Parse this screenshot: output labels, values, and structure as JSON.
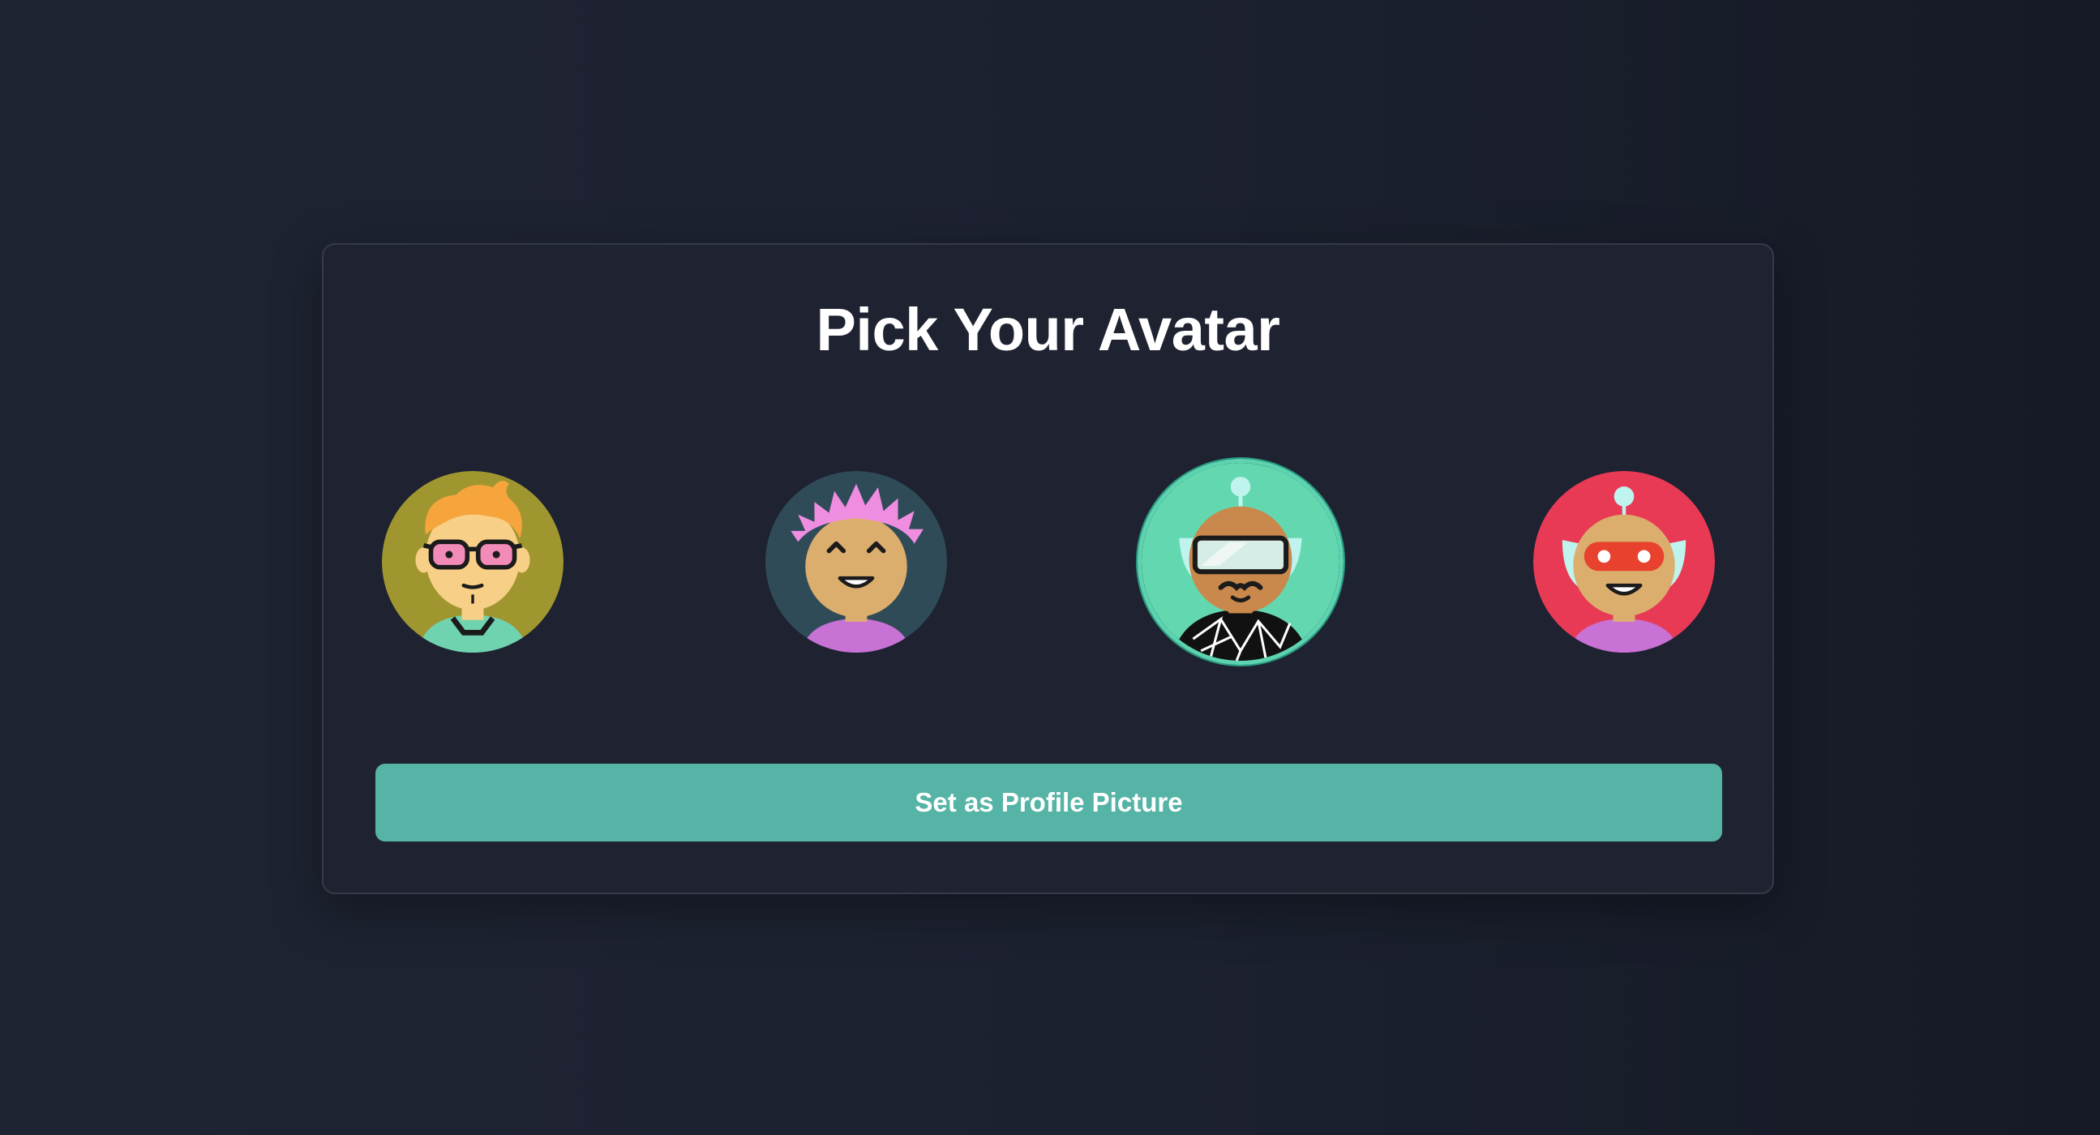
{
  "page": {
    "title": "Pick Your Avatar"
  },
  "avatars": [
    {
      "name": "avatar-1",
      "background": "#a09630",
      "selected": false
    },
    {
      "name": "avatar-2",
      "background": "#2f4b57",
      "selected": false
    },
    {
      "name": "avatar-3",
      "background": "#63d8b0",
      "selected": true
    },
    {
      "name": "avatar-4",
      "background": "#e83a55",
      "selected": false
    }
  ],
  "actions": {
    "set_profile_label": "Set as Profile Picture"
  },
  "colors": {
    "accent": "#55b4a6",
    "selected_ring": "#5ed3b0",
    "card": "#1e2231",
    "page_bg": "#1c2130"
  }
}
